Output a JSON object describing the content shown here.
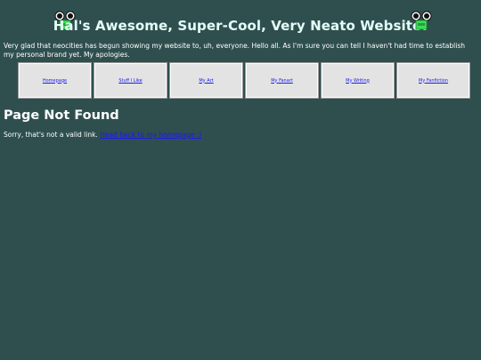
{
  "header": {
    "title": "Hal's Awesome, Super-Cool, Very Neato Website!",
    "left_icon": "frog-icon",
    "right_icon": "frog-icon"
  },
  "intro_text": "Very glad that neocities has begun showing my website to, uh, everyone. Hello all. As I'm sure you can tell I haven't had time to establish my personal brand yet. My apologies.",
  "nav": {
    "items": [
      {
        "label": "Homepage"
      },
      {
        "label": "Stuff I Like"
      },
      {
        "label": "My Art"
      },
      {
        "label": "My Fanart"
      },
      {
        "label": "My Writing"
      },
      {
        "label": "My Fanfiction"
      }
    ]
  },
  "main": {
    "heading": "Page Not Found",
    "message": "Sorry, that's not a valid link.",
    "back_link": "Head back to my homepage :)"
  },
  "colors": {
    "background": "#2f4f4f",
    "frog_green": "#3ddc5a",
    "link": "#1a1aee"
  }
}
